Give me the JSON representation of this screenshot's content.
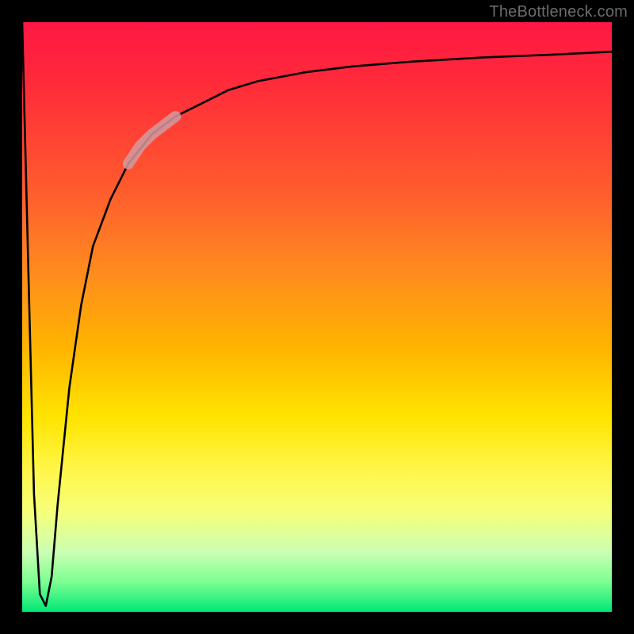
{
  "watermark": "TheBottleneck.com",
  "chart_data": {
    "type": "line",
    "title": "",
    "xlabel": "",
    "ylabel": "",
    "xlim": [
      0,
      100
    ],
    "ylim": [
      0,
      100
    ],
    "grid": false,
    "legend": false,
    "annotations": [],
    "series": [
      {
        "name": "bottleneck-curve",
        "x": [
          0,
          1,
          2,
          3,
          4,
          5,
          6,
          8,
          10,
          12,
          15,
          18,
          22,
          26,
          30,
          35,
          40,
          48,
          56,
          66,
          78,
          90,
          100
        ],
        "y": [
          100,
          60,
          20,
          3,
          1,
          6,
          18,
          38,
          52,
          62,
          70,
          76,
          81,
          84,
          86,
          88.5,
          90,
          91.5,
          92.5,
          93.3,
          94,
          94.5,
          95
        ]
      },
      {
        "name": "highlight-segment",
        "x": [
          18,
          20,
          22,
          24,
          26
        ],
        "y": [
          76,
          79,
          81,
          82.5,
          84
        ]
      }
    ],
    "colors": {
      "curve": "#000000",
      "highlight": "#d49aa0",
      "gradient_top": "#ff1744",
      "gradient_mid_upper": "#ff8a1f",
      "gradient_mid": "#ffe400",
      "gradient_mid_lower": "#c9ffb3",
      "gradient_bottom": "#00e676"
    }
  }
}
